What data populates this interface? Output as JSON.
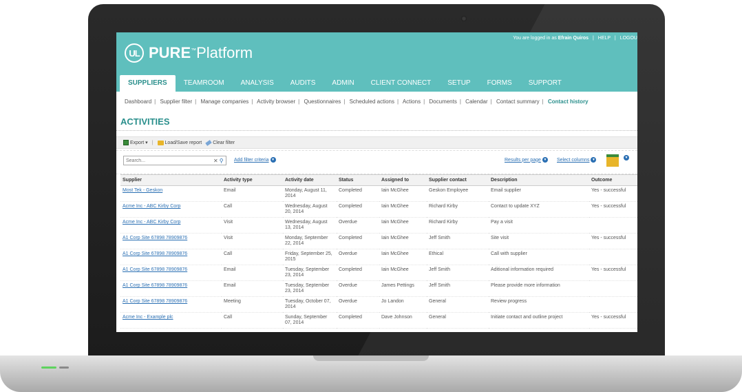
{
  "header": {
    "login_prefix": "You are logged in as",
    "user_name": "Efrain Quiros",
    "help": "HELP",
    "logout": "LOGOU"
  },
  "logo": {
    "mark": "UL",
    "brand_bold": "PURE",
    "tm": "™",
    "brand_light": "Platform"
  },
  "main_nav": [
    {
      "label": "SUPPLIERS"
    },
    {
      "label": "TEAMROOM"
    },
    {
      "label": "ANALYSIS"
    },
    {
      "label": "AUDITS"
    },
    {
      "label": "ADMIN"
    },
    {
      "label": "CLIENT CONNECT"
    },
    {
      "label": "SETUP"
    },
    {
      "label": "FORMS"
    },
    {
      "label": "SUPPORT"
    }
  ],
  "sub_nav": [
    {
      "label": "Dashboard"
    },
    {
      "label": "Supplier filter"
    },
    {
      "label": "Manage companies"
    },
    {
      "label": "Activity browser"
    },
    {
      "label": "Questionnaires"
    },
    {
      "label": "Scheduled actions"
    },
    {
      "label": "Actions"
    },
    {
      "label": "Documents"
    },
    {
      "label": "Calendar"
    },
    {
      "label": "Contact summary"
    },
    {
      "label": "Contact history"
    }
  ],
  "page_title": "ACTIVITIES",
  "toolbar": {
    "export": "Export ▾",
    "load_save": "Load/Save report",
    "clear_filter": "Clear filter"
  },
  "filters": {
    "search_placeholder": "Search...",
    "add_filter": "Add filter criteria",
    "results_per_page": "Results per page",
    "select_columns": "Select columns"
  },
  "table": {
    "columns": [
      "Supplier",
      "Activity type",
      "Activity date",
      "Status",
      "Assigned to",
      "Supplier contact",
      "Description",
      "Outcome"
    ],
    "rows": [
      [
        "Most Tek - Geskon",
        "Email",
        "Monday, August 11, 2014",
        "Completed",
        "Iain McGhee",
        "Geskon Employee",
        "Email supplier",
        "Yes - successful"
      ],
      [
        "Acme Inc - ABC Kirby Corp",
        "Call",
        "Wednesday, August 20, 2014",
        "Completed",
        "Iain McGhee",
        "Richard Kirby",
        "Contact to update XYZ",
        "Yes - successful"
      ],
      [
        "Acme Inc - ABC Kirby Corp",
        "Visit",
        "Wednesday, August 13, 2014",
        "Overdue",
        "Iain McGhee",
        "Richard Kirby",
        "Pay a visit",
        ""
      ],
      [
        "A1 Corp Site 67898 78909876",
        "Visit",
        "Monday, September 22, 2014",
        "Completed",
        "Iain McGhee",
        "Jeff Smith",
        "Site visit",
        "Yes - successful"
      ],
      [
        "A1 Corp Site 67898 78909876",
        "Call",
        "Friday, September 25, 2015",
        "Overdue",
        "Iain McGhee",
        "Ethical",
        "Call with supplier",
        ""
      ],
      [
        "A1 Corp Site 67898 78909876",
        "Email",
        "Tuesday, September 23, 2014",
        "Completed",
        "Iain McGhee",
        "Jeff Smith",
        "Aditional information required",
        "Yes - successful"
      ],
      [
        "A1 Corp Site 67898 78909876",
        "Email",
        "Tuesday, September 23, 2014",
        "Overdue",
        "James Pettings",
        "Jeff Smith",
        "Please provide more information",
        ""
      ],
      [
        "A1 Corp Site 67898 78909876",
        "Meeting",
        "Tuesday, October 07, 2014",
        "Overdue",
        "Jo Landon",
        "General",
        "Review progress",
        ""
      ],
      [
        "Acme Inc - Example plc",
        "Call",
        "Sunday, September 07, 2014",
        "Completed",
        "Dave Johnson",
        "General",
        "Initiate contact and outline project",
        "Yes - successful"
      ]
    ]
  },
  "colors": {
    "teal": "#5fbfbd",
    "teal_dark": "#2a8f8c",
    "link": "#2a6fb3"
  }
}
